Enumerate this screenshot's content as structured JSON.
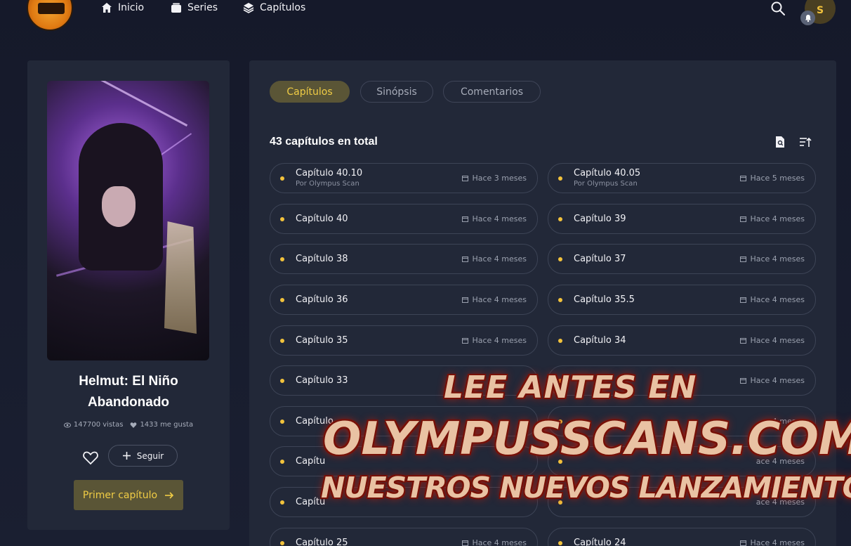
{
  "nav": {
    "items": [
      {
        "label": "Inicio",
        "icon": "home-icon"
      },
      {
        "label": "Series",
        "icon": "folder-icon"
      },
      {
        "label": "Capítulos",
        "icon": "layers-icon"
      }
    ],
    "avatar_letter": "S"
  },
  "series": {
    "title": "Helmut: El Niño Abandonado",
    "views": "147700 vistas",
    "likes": "1433 me gusta",
    "follow_label": "Seguir",
    "first_chapter_label": "Primer capítulo"
  },
  "tabs": [
    {
      "label": "Capítulos",
      "active": true
    },
    {
      "label": "Sinópsis",
      "active": false
    },
    {
      "label": "Comentarios",
      "active": false
    }
  ],
  "chapters_total": "43 capítulos en total",
  "chapters": [
    {
      "name": "Capítulo 40.10",
      "by": "Por Olympus Scan",
      "date": "Hace 3 meses"
    },
    {
      "name": "Capítulo 40.05",
      "by": "Por Olympus Scan",
      "date": "Hace 5 meses"
    },
    {
      "name": "Capítulo 40",
      "by": "",
      "date": "Hace 4 meses"
    },
    {
      "name": "Capítulo 39",
      "by": "",
      "date": "Hace 4 meses"
    },
    {
      "name": "Capítulo 38",
      "by": "",
      "date": "Hace 4 meses"
    },
    {
      "name": "Capítulo 37",
      "by": "",
      "date": "Hace 4 meses"
    },
    {
      "name": "Capítulo 36",
      "by": "",
      "date": "Hace 4 meses"
    },
    {
      "name": "Capítulo 35.5",
      "by": "",
      "date": "Hace 4 meses"
    },
    {
      "name": "Capítulo 35",
      "by": "",
      "date": "Hace 4 meses"
    },
    {
      "name": "Capítulo 34",
      "by": "",
      "date": "Hace 4 meses"
    },
    {
      "name": "Capítulo 33",
      "by": "",
      "date": ""
    },
    {
      "name": "",
      "by": "",
      "date": "Hace 4 meses"
    },
    {
      "name": "Capítulo",
      "by": "",
      "date": ""
    },
    {
      "name": "",
      "by": "",
      "date": "4 meses"
    },
    {
      "name": "Capítu",
      "by": "",
      "date": ""
    },
    {
      "name": "",
      "by": "",
      "date": "ace 4 meses"
    },
    {
      "name": "Capítu",
      "by": "",
      "date": ""
    },
    {
      "name": "",
      "by": "",
      "date": "ace 4 meses"
    },
    {
      "name": "Capítulo 25",
      "by": "",
      "date": "Hace 4 meses"
    },
    {
      "name": "Capítulo 24",
      "by": "",
      "date": "Hace 4 meses"
    }
  ],
  "watermark": {
    "line1": "LEE ANTES EN",
    "line2": "OLYMPUSSCANS.COM",
    "line3": "NUESTROS NUEVOS LANZAMIENTOS"
  }
}
